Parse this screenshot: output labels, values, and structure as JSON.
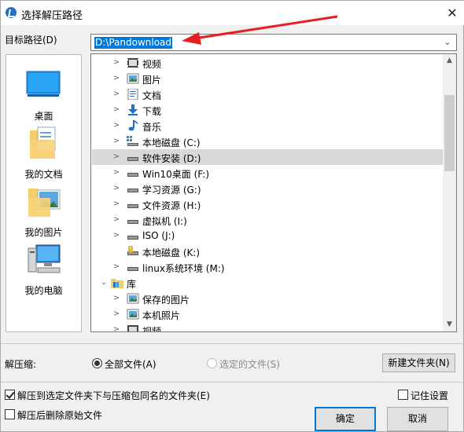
{
  "window": {
    "title": "选择解压路径"
  },
  "target": {
    "label": "目标路径(D)",
    "path": "D:\\Pandownload"
  },
  "places": [
    {
      "label": "桌面",
      "icon": "desktop-icon"
    },
    {
      "label": "我的文档",
      "icon": "documents-icon"
    },
    {
      "label": "我的图片",
      "icon": "pictures-icon"
    },
    {
      "label": "我的电脑",
      "icon": "computer-icon"
    }
  ],
  "tree": {
    "items": [
      {
        "label": "视频",
        "icon": "video-icon"
      },
      {
        "label": "图片",
        "icon": "picture-icon"
      },
      {
        "label": "文档",
        "icon": "document-icon"
      },
      {
        "label": "下载",
        "icon": "download-icon"
      },
      {
        "label": "音乐",
        "icon": "music-icon"
      },
      {
        "label": "本地磁盘 (C:)",
        "icon": "system-drive-icon"
      },
      {
        "label": "软件安装 (D:)",
        "icon": "drive-icon",
        "selected": true
      },
      {
        "label": "Win10桌面 (F:)",
        "icon": "drive-icon"
      },
      {
        "label": "学习资源 (G:)",
        "icon": "drive-icon"
      },
      {
        "label": "文件资源 (H:)",
        "icon": "drive-icon"
      },
      {
        "label": "虚拟机 (I:)",
        "icon": "drive-icon"
      },
      {
        "label": "ISO (J:)",
        "icon": "drive-icon"
      },
      {
        "label": "本地磁盘 (K:)",
        "icon": "locked-drive-icon"
      },
      {
        "label": "linux系统环境 (M:)",
        "icon": "drive-icon"
      },
      {
        "label": "库",
        "icon": "library-icon",
        "expanded": true
      },
      {
        "label": "保存的图片",
        "icon": "picture-icon"
      },
      {
        "label": "本机照片",
        "icon": "picture-icon"
      },
      {
        "label": "视频",
        "icon": "video-icon"
      }
    ]
  },
  "compress": {
    "label": "解压缩:",
    "option_all": "全部文件(A)",
    "option_selected": "选定的文件(S)",
    "new_folder": "新建文件夹(N)"
  },
  "options": {
    "extract_to_folder": "解压到选定文件夹下与压缩包同名的文件夹(E)",
    "delete_after": "解压后删除原始文件",
    "remember": "记住设置"
  },
  "buttons": {
    "ok": "确定",
    "cancel": "取消"
  },
  "colors": {
    "accent": "#0078d7",
    "arrow": "#e81e25"
  }
}
